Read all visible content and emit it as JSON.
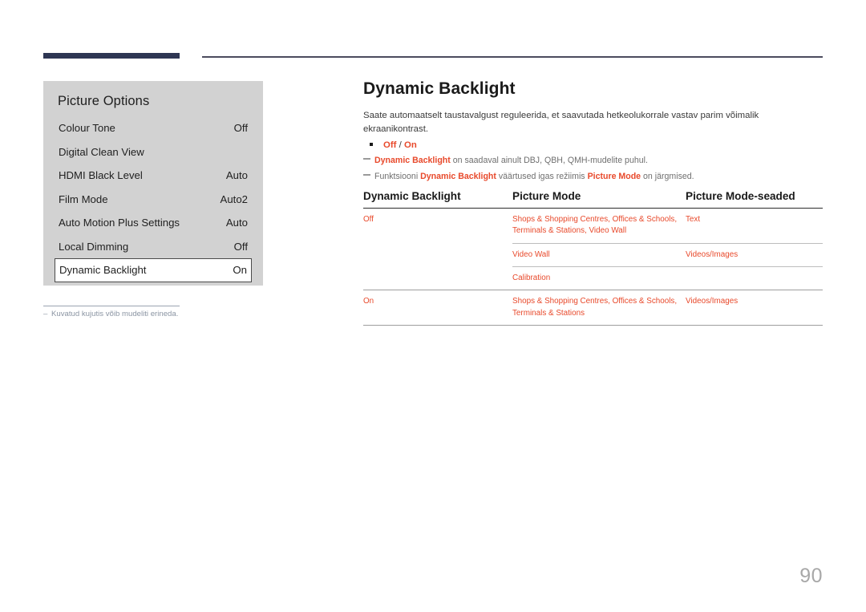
{
  "decor": {
    "navy_bar_color": "#2e3653",
    "thin_rule_color": "#4c4c5e",
    "accent_color": "#e8492b"
  },
  "osd": {
    "title": "Picture Options",
    "rows": [
      {
        "label": "Colour Tone",
        "value": "Off",
        "selected": false
      },
      {
        "label": "Digital Clean View",
        "value": "",
        "selected": false
      },
      {
        "label": "HDMI Black Level",
        "value": "Auto",
        "selected": false
      },
      {
        "label": "Film Mode",
        "value": "Auto2",
        "selected": false
      },
      {
        "label": "Auto Motion Plus Settings",
        "value": "Auto",
        "selected": false
      },
      {
        "label": "Local Dimming",
        "value": "Off",
        "selected": false
      },
      {
        "label": "Dynamic Backlight",
        "value": "On",
        "selected": true
      }
    ],
    "footnote": "Kuvatud kujutis võib mudeliti erineda.",
    "footnote_marker": "‒"
  },
  "content": {
    "title": "Dynamic Backlight",
    "intro": "Saate automaatselt taustavalgust reguleerida, et saavutada hetkeolukorrale vastav parim võimalik ekraanikontrast.",
    "bullet": {
      "option_off": "Off",
      "separator": " / ",
      "option_on": "On"
    },
    "notes": [
      {
        "highlight1": "Dynamic Backlight",
        "text1": " on saadaval ainult DBJ, QBH, QMH-mudelite puhul."
      },
      {
        "lead": "Funktsiooni ",
        "highlight1": "Dynamic Backlight",
        "mid": " väärtused igas režiimis ",
        "highlight2": "Picture Mode",
        "tail": " on järgmised."
      }
    ]
  },
  "table": {
    "headers": [
      "Dynamic Backlight",
      "Picture Mode",
      "Picture Mode-seaded"
    ],
    "rows": [
      {
        "backlight": "Off",
        "picture_mode": "Shops & Shopping Centres, Offices & Schools, Terminals & Stations, Video Wall",
        "picture_mode_settings": "Text"
      },
      {
        "backlight": "",
        "picture_mode": "Video Wall",
        "picture_mode_settings": "Videos/Images"
      },
      {
        "backlight": "",
        "picture_mode": "Calibration",
        "picture_mode_settings": ""
      },
      {
        "backlight": "On",
        "picture_mode": "Shops & Shopping Centres, Offices & Schools, Terminals & Stations",
        "picture_mode_settings": "Videos/Images"
      }
    ]
  },
  "page_number": "90"
}
